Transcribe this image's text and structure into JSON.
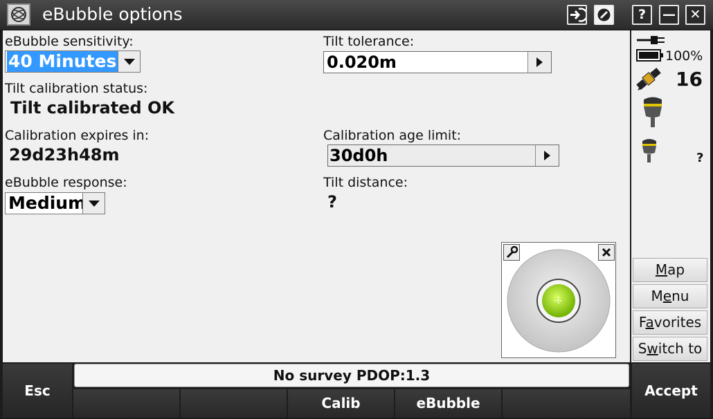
{
  "window": {
    "title": "eBubble options",
    "logo_icon": "trimble-globe-icon",
    "buttons": {
      "login_icon": "login-arrow-icon",
      "disable_icon": "no-entry-icon",
      "help": "?",
      "minimize": "—",
      "close": "✕"
    }
  },
  "form": {
    "sensitivity": {
      "label": "eBubble sensitivity:",
      "value": "40 Minutes"
    },
    "tilt_tolerance": {
      "label": "Tilt tolerance:",
      "value": "0.020m"
    },
    "calibration_status": {
      "label": "Tilt calibration status:",
      "value": "Tilt calibrated OK"
    },
    "expires": {
      "label": "Calibration expires in:",
      "value": "29d23h48m"
    },
    "age_limit": {
      "label": "Calibration age limit:",
      "value": "30d0h"
    },
    "response": {
      "label": "eBubble response:",
      "value": "Medium"
    },
    "tilt_distance": {
      "label": "Tilt distance:",
      "value": "?"
    }
  },
  "bubble": {
    "settings_icon": "wrench-icon",
    "close_icon": "close-icon",
    "accent": "#8fd400"
  },
  "status": {
    "power_icon": "power-plug-icon",
    "battery_icon": "battery-icon",
    "battery_percent": "100%",
    "satellite_icon": "satellite-icon",
    "satellites": "16",
    "receiver_icon": "gnss-receiver-icon",
    "rover_icon": "rover-receiver-icon",
    "rover_status": "?"
  },
  "sidebar": {
    "buttons": [
      {
        "label": "Map",
        "mnemonic": "M",
        "rest": "ap"
      },
      {
        "label": "Menu",
        "pre": "M",
        "mnemonic": "e",
        "rest": "nu"
      },
      {
        "label": "Favorites",
        "pre": "F",
        "mnemonic": "a",
        "rest": "vorites"
      },
      {
        "label": "Switch to",
        "pre": "S",
        "mnemonic": "w",
        "rest": "itch to"
      }
    ]
  },
  "bottom": {
    "esc": "Esc",
    "accept": "Accept",
    "status_text": "No survey  PDOP:1.3",
    "softkeys": [
      "",
      "",
      "Calib",
      "eBubble",
      ""
    ]
  },
  "colors": {
    "selection": "#3399ff",
    "bubble_green": "#8fd400"
  }
}
